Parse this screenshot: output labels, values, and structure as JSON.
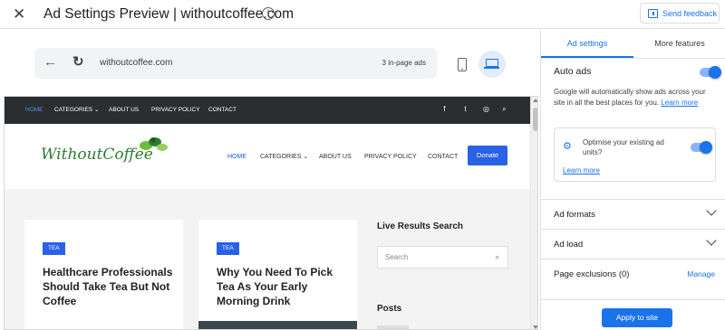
{
  "header": {
    "close_icon": "✕",
    "title": "Ad Settings Preview | withoutcoffee.com",
    "info_icon": "i",
    "feedback_label": "Send feedback"
  },
  "browser": {
    "back_icon": "←",
    "reload_icon": "↻",
    "url": "withoutcoffee.com",
    "ads_count": "3 in-page ads",
    "selected_device": "desktop"
  },
  "site": {
    "top_nav": [
      "HOME",
      "CATEGORIES ⌄",
      "ABOUT US",
      "PRIVACY POLICY",
      "CONTACT"
    ],
    "social_icons": [
      "f",
      "t",
      "◎",
      "⌕"
    ],
    "logo_text": "WithoutCoffee",
    "main_nav": [
      "HOME",
      "CATEGORIES ⌄",
      "ABOUT US",
      "PRIVACY POLICY",
      "CONTACT"
    ],
    "donate_label": "Donate",
    "cards": [
      {
        "tag": "TEA",
        "title": "Healthcare Professionals Should Take Tea But Not Coffee"
      },
      {
        "tag": "TEA",
        "title": "Why You Need To Pick Tea As Your Early Morning Drink"
      }
    ],
    "widget_title": "Live Results Search",
    "search_placeholder": "Search",
    "search_icon": "⌕",
    "posts_title": "Posts"
  },
  "panel": {
    "tabs": [
      "Ad settings",
      "More features"
    ],
    "active_tab": "Ad settings",
    "auto_ads": {
      "title": "Auto ads",
      "enabled": true,
      "description": "Google will automatically show ads across your site in all the best places for you.",
      "learn_more": "Learn more"
    },
    "optimise": {
      "text": "Optimise your existing ad units?",
      "enabled": true,
      "learn_more": "Learn more"
    },
    "rows": [
      {
        "label": "Ad formats"
      },
      {
        "label": "Ad load"
      },
      {
        "label": "Page exclusions (0)",
        "action": "Manage"
      }
    ],
    "apply_label": "Apply to site"
  },
  "colors": {
    "accent": "#1a73e8",
    "site_nav_bg": "#2b2e31",
    "donate_bg": "#2a62e5",
    "logo_green": "#2e7d32"
  }
}
